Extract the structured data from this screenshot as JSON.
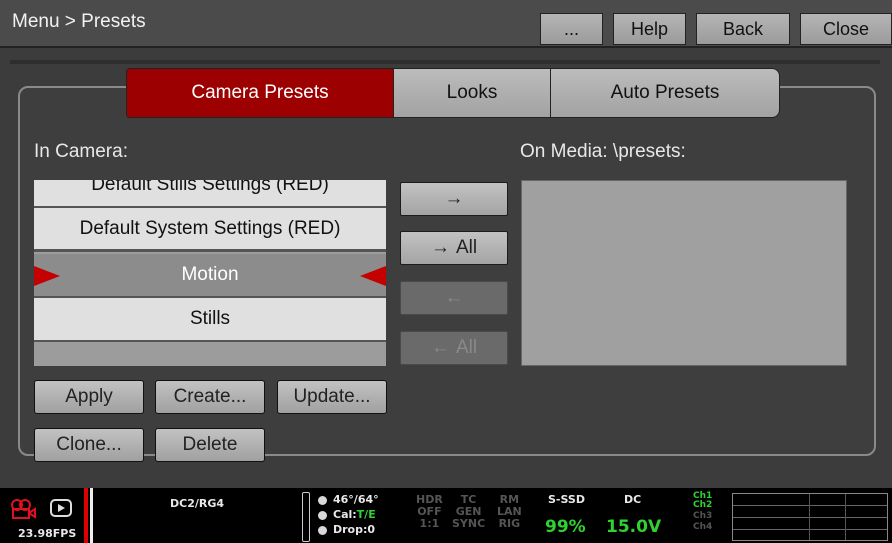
{
  "header": {
    "path": "Menu > Presets",
    "buttons": {
      "more": "...",
      "help": "Help",
      "back": "Back",
      "close": "Close"
    }
  },
  "tabs": [
    {
      "label": "Camera Presets",
      "active": true
    },
    {
      "label": "Looks",
      "active": false
    },
    {
      "label": "Auto Presets",
      "active": false
    }
  ],
  "in_camera": {
    "label": "In Camera:",
    "items": [
      {
        "label": "Default Stills Settings (RED)",
        "selected": false
      },
      {
        "label": "Default System Settings (RED)",
        "selected": false
      },
      {
        "label": "Motion",
        "selected": true
      },
      {
        "label": "Stills",
        "selected": false
      }
    ]
  },
  "on_media": {
    "label": "On Media: \\presets:"
  },
  "transfer": {
    "copy_one": {
      "label": "",
      "arrow": "→",
      "enabled": true
    },
    "copy_all": {
      "label": "All",
      "arrow": "→",
      "enabled": true
    },
    "import_one": {
      "label": "",
      "arrow": "←",
      "enabled": false
    },
    "import_all": {
      "label": "All",
      "arrow": "←",
      "enabled": false
    }
  },
  "actions": {
    "apply": "Apply",
    "create": "Create...",
    "update": "Update...",
    "clone": "Clone...",
    "delete": "Delete"
  },
  "status_bar": {
    "fps": "23.98FPS",
    "look": "DC2/RG4",
    "shutter": "46°/64°",
    "cal_label": "Cal:",
    "cal_value": "T/E",
    "drop": "Drop:0",
    "hdr": [
      "HDR",
      "OFF",
      "1:1"
    ],
    "tc": [
      "TC",
      "GEN",
      "SYNC"
    ],
    "rm": [
      "RM",
      "LAN",
      "RIG"
    ],
    "media_label": "S-SSD",
    "media_value": "99%",
    "power_label": "DC",
    "power_value": "15.0V",
    "channels": [
      "Ch1",
      "Ch2",
      "Ch3",
      "Ch4"
    ],
    "colors": {
      "accent_red": "#9c0000",
      "arrow_red": "#c40000",
      "green": "#2fd22f"
    }
  }
}
